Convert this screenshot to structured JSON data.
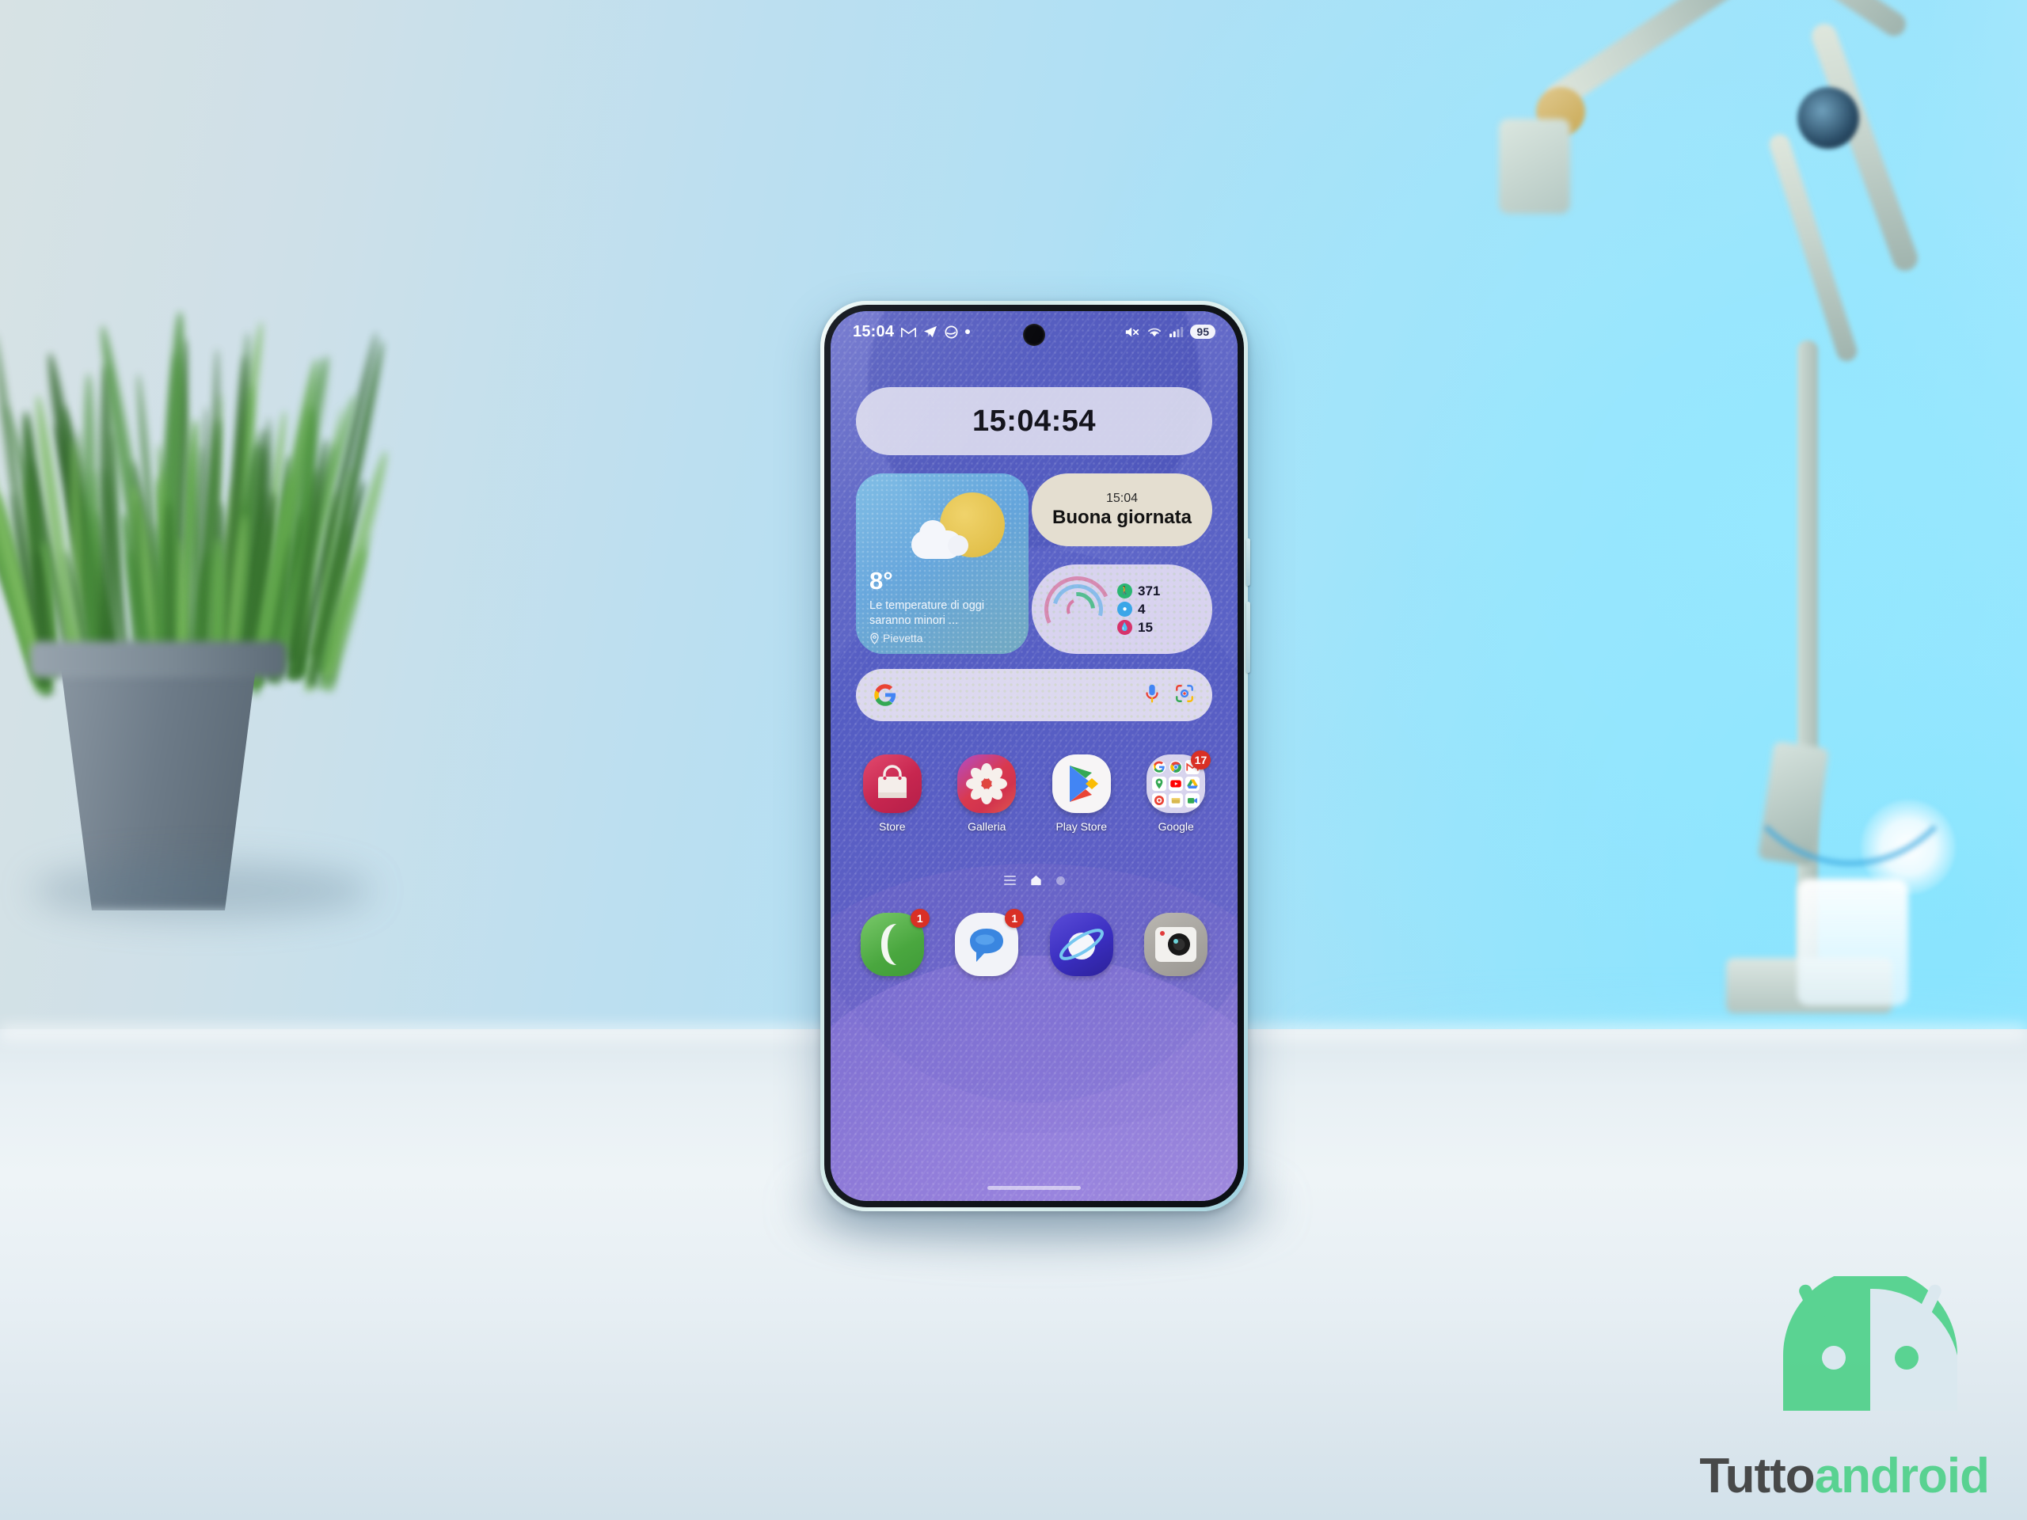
{
  "scene": {
    "description": "Smartphone standing on white desk photographed against light blue wall",
    "objects": {
      "plant_label": "potted-grass-plant",
      "lamp_label": "desk-lamp",
      "desk_label": "white-desk-surface"
    }
  },
  "phone": {
    "status_bar": {
      "time": "15:04",
      "left_icons": [
        "gmail-icon",
        "telegram-icon",
        "edge-icon",
        "dot-icon"
      ],
      "right_icons": [
        "mute-icon",
        "wifi-icon",
        "signal-icon"
      ],
      "battery": "95"
    },
    "clock_widget": {
      "time": "15:04:54"
    },
    "weather_widget": {
      "temperature": "8°",
      "description": "Le temperature di oggi saranno minori ...",
      "location": "Pievetta",
      "condition_icon": "sun-behind-cloud-icon"
    },
    "greeting_widget": {
      "time": "15:04",
      "message": "Buona giornata"
    },
    "health_widget": {
      "rows": [
        {
          "icon": "steps-icon",
          "value": "371",
          "color": "#2bb673"
        },
        {
          "icon": "water-icon",
          "value": "4",
          "color": "#3aa6e8"
        },
        {
          "icon": "activity-icon",
          "value": "15",
          "color": "#d6336c"
        }
      ]
    },
    "search_bar": {
      "placeholder": "",
      "leading_icon": "google-g-icon",
      "trailing_icons": [
        "microphone-icon",
        "google-lens-icon"
      ]
    },
    "app_row": [
      {
        "label": "Store",
        "icon": "galaxy-store-icon",
        "badge": ""
      },
      {
        "label": "Galleria",
        "icon": "gallery-flower-icon",
        "badge": ""
      },
      {
        "label": "Play Store",
        "icon": "play-store-icon",
        "badge": ""
      },
      {
        "label": "Google",
        "icon": "google-folder-icon",
        "badge": "17"
      }
    ],
    "page_indicator": {
      "items": [
        "app-list-icon",
        "home-icon",
        "page-dot-icon"
      ],
      "active": 1
    },
    "dock": [
      {
        "label": "Telefono",
        "icon": "phone-icon",
        "badge": "1"
      },
      {
        "label": "Messaggi",
        "icon": "messages-icon",
        "badge": "1"
      },
      {
        "label": "Internet",
        "icon": "samsung-internet-icon",
        "badge": ""
      },
      {
        "label": "Fotocamera",
        "icon": "camera-icon",
        "badge": ""
      }
    ]
  },
  "watermark": {
    "text_part1": "Tutto",
    "text_part2": "android",
    "logo": "android-head-icon"
  },
  "colors": {
    "wallpaper": "#5b63c4",
    "accent_green": "#4fd18a",
    "badge_red": "#d93025",
    "wall_blue": "#a7e2f8"
  }
}
